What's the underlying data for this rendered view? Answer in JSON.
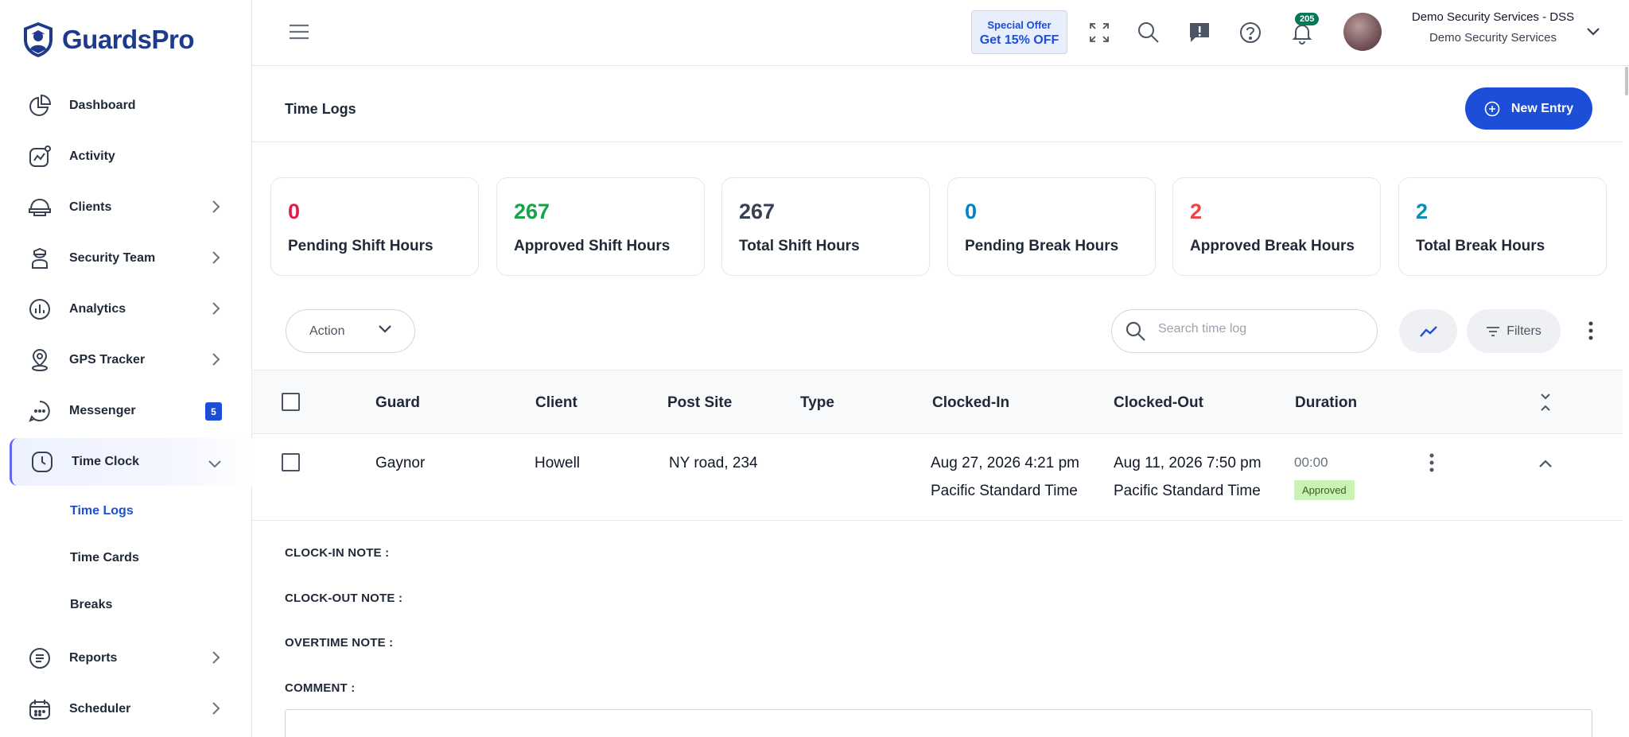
{
  "brand": {
    "name": "GuardsPro"
  },
  "sidebar": {
    "items": [
      {
        "label": "Dashboard",
        "icon": "pie-chart-icon"
      },
      {
        "label": "Activity",
        "icon": "activity-icon"
      },
      {
        "label": "Clients",
        "icon": "helmet-icon"
      },
      {
        "label": "Security Team",
        "icon": "guard-icon"
      },
      {
        "label": "Analytics",
        "icon": "bar-chart-icon"
      },
      {
        "label": "GPS Tracker",
        "icon": "location-pin-icon"
      },
      {
        "label": "Messenger",
        "icon": "chat-icon",
        "badge": "5"
      },
      {
        "label": "Time Clock",
        "icon": "clock-icon"
      },
      {
        "label": "Reports",
        "icon": "document-icon"
      },
      {
        "label": "Scheduler",
        "icon": "calendar-icon"
      }
    ],
    "time_clock_sub": [
      "Time Logs",
      "Time Cards",
      "Breaks"
    ]
  },
  "topbar": {
    "offer_line1": "Special Offer",
    "offer_line2": "Get 15% OFF",
    "notification_count": "205",
    "org_name": "Demo Security Services - DSS",
    "org_sub": "Demo Security Services"
  },
  "page": {
    "title": "Time Logs",
    "new_entry_label": "New Entry"
  },
  "stats": [
    {
      "value": "0",
      "label": "Pending Shift Hours",
      "color": "#e11d48"
    },
    {
      "value": "267",
      "label": "Approved Shift Hours",
      "color": "#16a34a"
    },
    {
      "value": "267",
      "label": "Total Shift Hours",
      "color": "#374151"
    },
    {
      "value": "0",
      "label": "Pending Break Hours",
      "color": "#0284c7"
    },
    {
      "value": "2",
      "label": "Approved Break Hours",
      "color": "#ef4444"
    },
    {
      "value": "2",
      "label": "Total Break Hours",
      "color": "#0891b2"
    }
  ],
  "toolbar": {
    "action_label": "Action",
    "search_placeholder": "Search time log",
    "filters_label": "Filters"
  },
  "table": {
    "columns": [
      "Guard",
      "Client",
      "Post Site",
      "Type",
      "Clocked-In",
      "Clocked-Out",
      "Duration"
    ],
    "rows": [
      {
        "guard": "Gaynor",
        "client": "Howell",
        "post_site": "NY road, 234",
        "type": "",
        "clocked_in": "Aug 27, 2026 4:21 pm",
        "clocked_in_tz": "Pacific Standard Time",
        "clocked_out": "Aug 11, 2026 7:50 pm",
        "clocked_out_tz": "Pacific Standard Time",
        "duration": "00:00",
        "status": "Approved"
      }
    ]
  },
  "details": {
    "clock_in_note": "CLOCK-IN NOTE :",
    "clock_out_note": "CLOCK-OUT NOTE :",
    "overtime_note": "OVERTIME NOTE :",
    "comment": "COMMENT :"
  }
}
